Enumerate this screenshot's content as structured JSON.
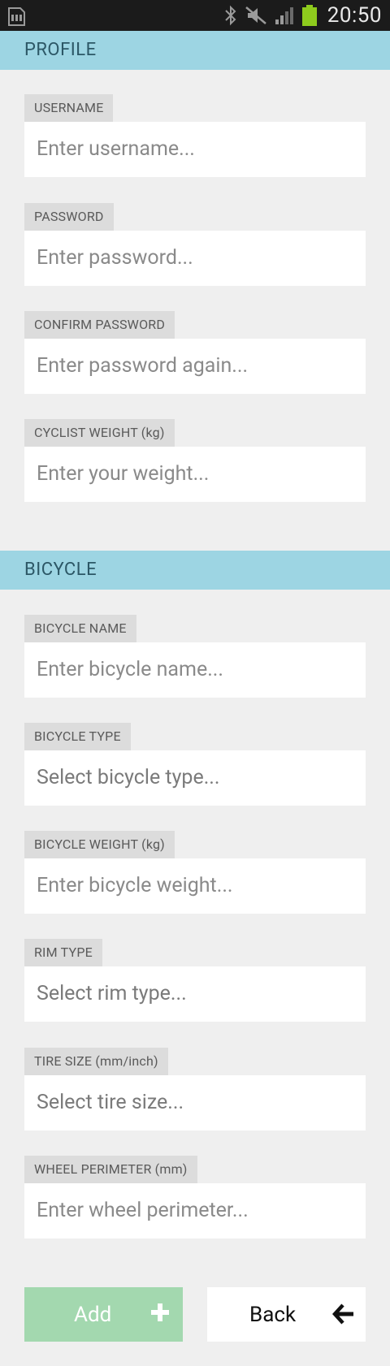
{
  "status_bar": {
    "time": "20:50",
    "icons": [
      "sd-card-icon",
      "bluetooth-icon",
      "mute-icon",
      "signal-icon",
      "battery-icon"
    ],
    "battery_color": "#8ecb1d"
  },
  "profile": {
    "header": "PROFILE",
    "fields": [
      {
        "label": "USERNAME",
        "placeholder": "Enter username...",
        "value": ""
      },
      {
        "label": "PASSWORD",
        "placeholder": "Enter password...",
        "value": ""
      },
      {
        "label": "CONFIRM PASSWORD",
        "placeholder": "Enter password again...",
        "value": ""
      },
      {
        "label": "CYCLIST WEIGHT (kg)",
        "placeholder": "Enter your weight...",
        "value": ""
      }
    ]
  },
  "bicycle": {
    "header": "BICYCLE",
    "fields": [
      {
        "label": "BICYCLE NAME",
        "placeholder": "Enter bicycle name...",
        "value": ""
      },
      {
        "label": "BICYCLE TYPE",
        "placeholder": "Select bicycle type...",
        "value": ""
      },
      {
        "label": "BICYCLE WEIGHT (kg)",
        "placeholder": "Enter bicycle weight...",
        "value": ""
      },
      {
        "label": "RIM TYPE",
        "placeholder": "Select rim type...",
        "value": ""
      },
      {
        "label": "TIRE SIZE (mm/inch)",
        "placeholder": "Select tire size...",
        "value": ""
      },
      {
        "label": "WHEEL PERIMETER (mm)",
        "placeholder": "Enter wheel perimeter...",
        "value": ""
      }
    ]
  },
  "actions": {
    "add_label": "Add",
    "add_icon": "plus-icon",
    "back_label": "Back",
    "back_icon": "arrow-left-icon"
  },
  "colors": {
    "section_header_bg": "#9dd5e3",
    "add_button_bg": "#a3d8af",
    "background": "#efefef"
  }
}
